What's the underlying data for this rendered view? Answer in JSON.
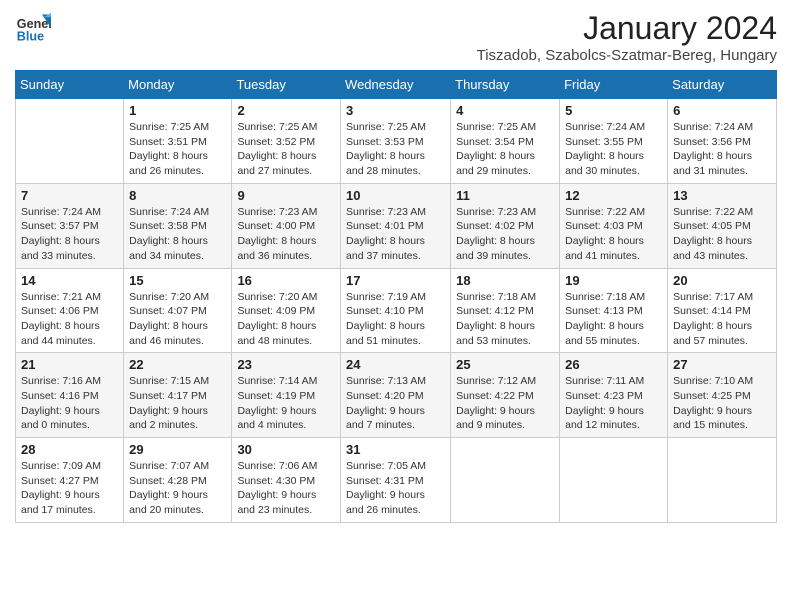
{
  "logo": {
    "line1": "General",
    "line2": "Blue"
  },
  "title": "January 2024",
  "subtitle": "Tiszadob, Szabolcs-Szatmar-Bereg, Hungary",
  "headers": [
    "Sunday",
    "Monday",
    "Tuesday",
    "Wednesday",
    "Thursday",
    "Friday",
    "Saturday"
  ],
  "weeks": [
    {
      "shaded": false,
      "days": [
        {
          "number": "",
          "info": ""
        },
        {
          "number": "1",
          "info": "Sunrise: 7:25 AM\nSunset: 3:51 PM\nDaylight: 8 hours\nand 26 minutes."
        },
        {
          "number": "2",
          "info": "Sunrise: 7:25 AM\nSunset: 3:52 PM\nDaylight: 8 hours\nand 27 minutes."
        },
        {
          "number": "3",
          "info": "Sunrise: 7:25 AM\nSunset: 3:53 PM\nDaylight: 8 hours\nand 28 minutes."
        },
        {
          "number": "4",
          "info": "Sunrise: 7:25 AM\nSunset: 3:54 PM\nDaylight: 8 hours\nand 29 minutes."
        },
        {
          "number": "5",
          "info": "Sunrise: 7:24 AM\nSunset: 3:55 PM\nDaylight: 8 hours\nand 30 minutes."
        },
        {
          "number": "6",
          "info": "Sunrise: 7:24 AM\nSunset: 3:56 PM\nDaylight: 8 hours\nand 31 minutes."
        }
      ]
    },
    {
      "shaded": true,
      "days": [
        {
          "number": "7",
          "info": "Sunrise: 7:24 AM\nSunset: 3:57 PM\nDaylight: 8 hours\nand 33 minutes."
        },
        {
          "number": "8",
          "info": "Sunrise: 7:24 AM\nSunset: 3:58 PM\nDaylight: 8 hours\nand 34 minutes."
        },
        {
          "number": "9",
          "info": "Sunrise: 7:23 AM\nSunset: 4:00 PM\nDaylight: 8 hours\nand 36 minutes."
        },
        {
          "number": "10",
          "info": "Sunrise: 7:23 AM\nSunset: 4:01 PM\nDaylight: 8 hours\nand 37 minutes."
        },
        {
          "number": "11",
          "info": "Sunrise: 7:23 AM\nSunset: 4:02 PM\nDaylight: 8 hours\nand 39 minutes."
        },
        {
          "number": "12",
          "info": "Sunrise: 7:22 AM\nSunset: 4:03 PM\nDaylight: 8 hours\nand 41 minutes."
        },
        {
          "number": "13",
          "info": "Sunrise: 7:22 AM\nSunset: 4:05 PM\nDaylight: 8 hours\nand 43 minutes."
        }
      ]
    },
    {
      "shaded": false,
      "days": [
        {
          "number": "14",
          "info": "Sunrise: 7:21 AM\nSunset: 4:06 PM\nDaylight: 8 hours\nand 44 minutes."
        },
        {
          "number": "15",
          "info": "Sunrise: 7:20 AM\nSunset: 4:07 PM\nDaylight: 8 hours\nand 46 minutes."
        },
        {
          "number": "16",
          "info": "Sunrise: 7:20 AM\nSunset: 4:09 PM\nDaylight: 8 hours\nand 48 minutes."
        },
        {
          "number": "17",
          "info": "Sunrise: 7:19 AM\nSunset: 4:10 PM\nDaylight: 8 hours\nand 51 minutes."
        },
        {
          "number": "18",
          "info": "Sunrise: 7:18 AM\nSunset: 4:12 PM\nDaylight: 8 hours\nand 53 minutes."
        },
        {
          "number": "19",
          "info": "Sunrise: 7:18 AM\nSunset: 4:13 PM\nDaylight: 8 hours\nand 55 minutes."
        },
        {
          "number": "20",
          "info": "Sunrise: 7:17 AM\nSunset: 4:14 PM\nDaylight: 8 hours\nand 57 minutes."
        }
      ]
    },
    {
      "shaded": true,
      "days": [
        {
          "number": "21",
          "info": "Sunrise: 7:16 AM\nSunset: 4:16 PM\nDaylight: 9 hours\nand 0 minutes."
        },
        {
          "number": "22",
          "info": "Sunrise: 7:15 AM\nSunset: 4:17 PM\nDaylight: 9 hours\nand 2 minutes."
        },
        {
          "number": "23",
          "info": "Sunrise: 7:14 AM\nSunset: 4:19 PM\nDaylight: 9 hours\nand 4 minutes."
        },
        {
          "number": "24",
          "info": "Sunrise: 7:13 AM\nSunset: 4:20 PM\nDaylight: 9 hours\nand 7 minutes."
        },
        {
          "number": "25",
          "info": "Sunrise: 7:12 AM\nSunset: 4:22 PM\nDaylight: 9 hours\nand 9 minutes."
        },
        {
          "number": "26",
          "info": "Sunrise: 7:11 AM\nSunset: 4:23 PM\nDaylight: 9 hours\nand 12 minutes."
        },
        {
          "number": "27",
          "info": "Sunrise: 7:10 AM\nSunset: 4:25 PM\nDaylight: 9 hours\nand 15 minutes."
        }
      ]
    },
    {
      "shaded": false,
      "days": [
        {
          "number": "28",
          "info": "Sunrise: 7:09 AM\nSunset: 4:27 PM\nDaylight: 9 hours\nand 17 minutes."
        },
        {
          "number": "29",
          "info": "Sunrise: 7:07 AM\nSunset: 4:28 PM\nDaylight: 9 hours\nand 20 minutes."
        },
        {
          "number": "30",
          "info": "Sunrise: 7:06 AM\nSunset: 4:30 PM\nDaylight: 9 hours\nand 23 minutes."
        },
        {
          "number": "31",
          "info": "Sunrise: 7:05 AM\nSunset: 4:31 PM\nDaylight: 9 hours\nand 26 minutes."
        },
        {
          "number": "",
          "info": ""
        },
        {
          "number": "",
          "info": ""
        },
        {
          "number": "",
          "info": ""
        }
      ]
    }
  ]
}
